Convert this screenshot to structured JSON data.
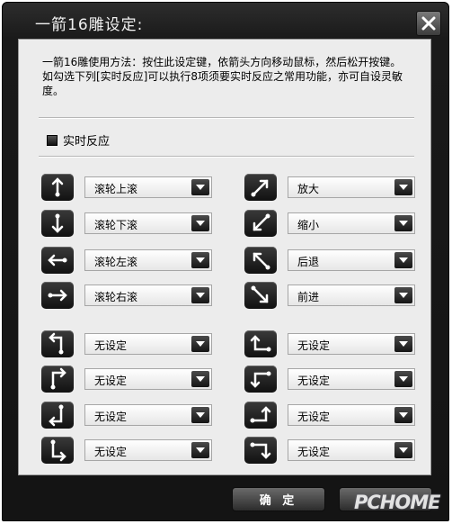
{
  "window": {
    "title": "一箭16雕设定:"
  },
  "instructions": "一箭16雕使用方法：按住此设定键，依箭头方向移动鼠标，然后松开按键。如勾选下列[实时反应]可以执行8项须要实时反应之常用功能，亦可自设灵敏度。",
  "realtime": {
    "label": "实时反应",
    "checked": true
  },
  "gestures": {
    "left": [
      {
        "icon": "arrow-up-down-icon",
        "value": "滚轮上滚"
      },
      {
        "icon": "arrow-down-up-icon",
        "value": "滚轮下滚"
      },
      {
        "icon": "arrow-left-icon",
        "value": "滚轮左滚"
      },
      {
        "icon": "arrow-right-icon",
        "value": "滚轮右滚"
      },
      {
        "icon": "path-up-left-icon",
        "value": "无设定"
      },
      {
        "icon": "path-up-right-icon",
        "value": "无设定"
      },
      {
        "icon": "path-down-left-icon",
        "value": "无设定"
      },
      {
        "icon": "path-down-right-icon",
        "value": "无设定"
      }
    ],
    "right": [
      {
        "icon": "arrow-diagonal-up-right-icon",
        "value": "放大"
      },
      {
        "icon": "arrow-diagonal-down-left-icon",
        "value": "缩小"
      },
      {
        "icon": "arrow-diagonal-up-left-icon",
        "value": "后退"
      },
      {
        "icon": "arrow-diagonal-down-right-icon",
        "value": "前进"
      },
      {
        "icon": "path-left-up-icon",
        "value": "无设定"
      },
      {
        "icon": "path-left-down-icon",
        "value": "无设定"
      },
      {
        "icon": "path-right-up-icon",
        "value": "无设定"
      },
      {
        "icon": "path-right-down-icon",
        "value": "无设定"
      }
    ]
  },
  "buttons": {
    "ok": "确 定"
  },
  "watermark": "PCHOME"
}
